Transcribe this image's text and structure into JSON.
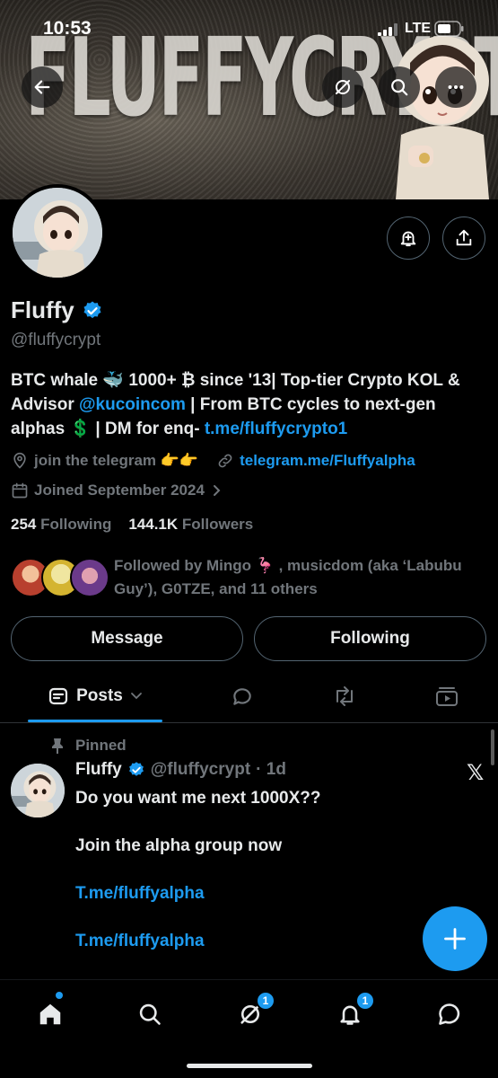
{
  "status_bar": {
    "time": "10:53",
    "network": "LTE"
  },
  "banner": {
    "text": "FLUFFYCRYPT"
  },
  "profile": {
    "name": "Fluffy",
    "handle": "@fluffycrypt",
    "bio_part1": "BTC whale 🐳 1000+ ₿ since '13| Top-tier Crypto KOL & Advisor ",
    "bio_mention": "@kucoincom",
    "bio_part2": " | From BTC cycles to next-gen alphas 💲 | DM for enq- ",
    "bio_link": "t.me/fluffycrypto1",
    "location": "join the telegram 👉👉",
    "website": "telegram.me/Fluffyalpha",
    "joined": "Joined September 2024",
    "following_count": "254",
    "following_label": "Following",
    "followers_count": "144.1K",
    "followers_label": "Followers",
    "followed_by": "Followed by Mingo 🦩 , musicdom (aka ‘Labubu Guy’), G0TZE, and 11 others"
  },
  "buttons": {
    "message": "Message",
    "following": "Following"
  },
  "tabs": {
    "posts": "Posts"
  },
  "post": {
    "pinned_label": "Pinned",
    "author_name": "Fluffy",
    "author_handle": "@fluffycrypt",
    "time": "· 1d",
    "lines": [
      "Do you want me next 1000X??",
      "Join the alpha group now",
      "T.me/fluffyalpha",
      "T.me/fluffyalpha"
    ]
  },
  "nav": {
    "grok_badge": "1",
    "notifications_badge": "1"
  },
  "colors": {
    "accent": "#1d9bf0",
    "background": "#000000",
    "muted": "#71767b"
  }
}
